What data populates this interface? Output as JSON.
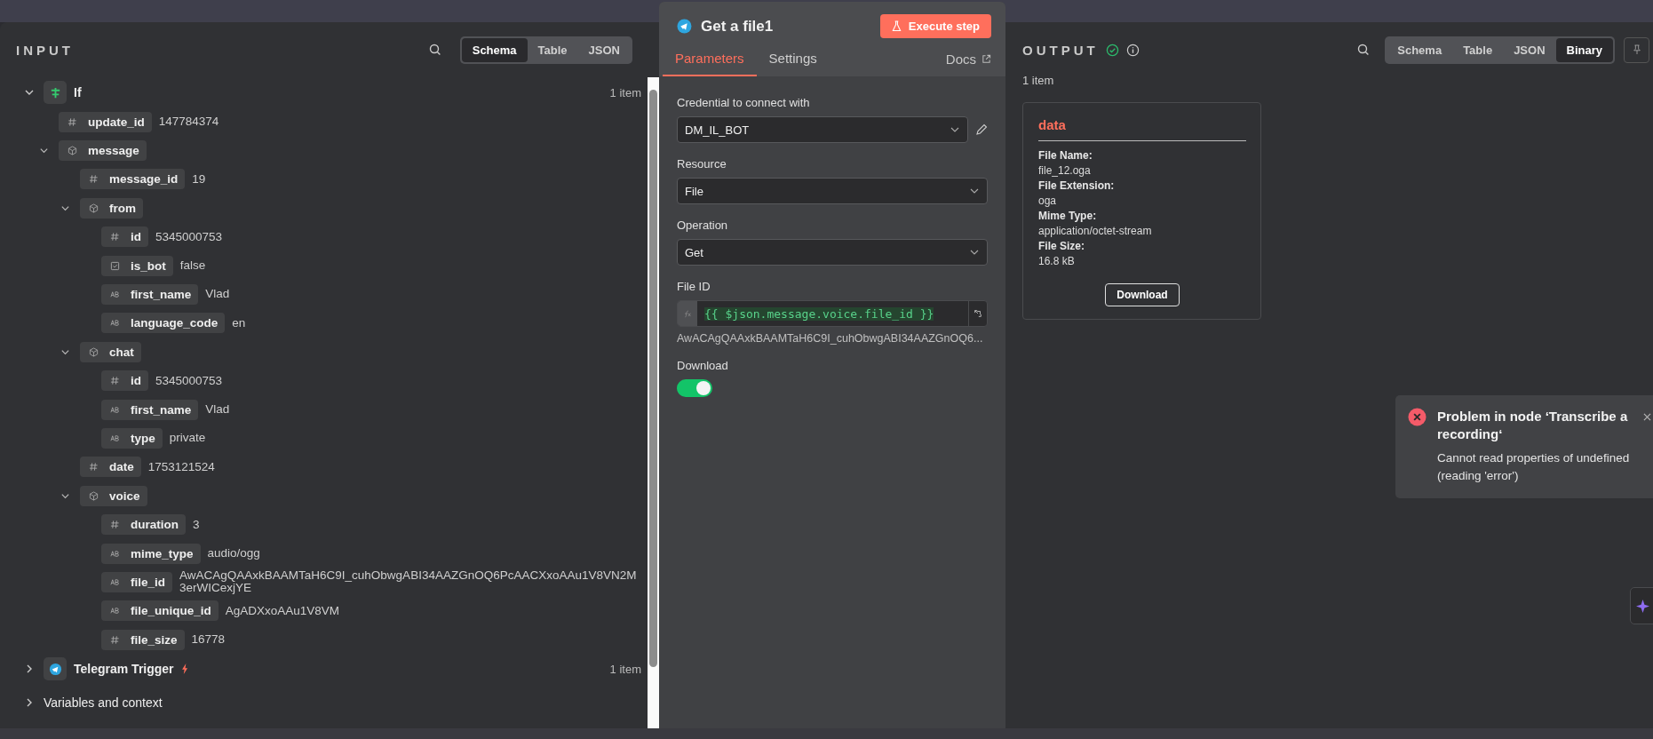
{
  "input": {
    "title": "INPUT",
    "views": [
      {
        "label": "Schema",
        "selected": true
      },
      {
        "label": "Table",
        "selected": false
      },
      {
        "label": "JSON",
        "selected": false
      }
    ],
    "sources": [
      {
        "name": "If",
        "kind": "if",
        "trigger": false,
        "count": "1 item",
        "expanded": true,
        "fields": [
          {
            "key": "update_id",
            "kind": "number",
            "value": "147784374"
          },
          {
            "key": "message",
            "kind": "object",
            "expanded": true,
            "children": [
              {
                "key": "message_id",
                "kind": "number",
                "value": "19"
              },
              {
                "key": "from",
                "kind": "object",
                "expanded": true,
                "children": [
                  {
                    "key": "id",
                    "kind": "number",
                    "value": "5345000753"
                  },
                  {
                    "key": "is_bot",
                    "kind": "boolean",
                    "value": "false"
                  },
                  {
                    "key": "first_name",
                    "kind": "string",
                    "value": "Vlad"
                  },
                  {
                    "key": "language_code",
                    "kind": "string",
                    "value": "en"
                  }
                ]
              },
              {
                "key": "chat",
                "kind": "object",
                "expanded": true,
                "children": [
                  {
                    "key": "id",
                    "kind": "number",
                    "value": "5345000753"
                  },
                  {
                    "key": "first_name",
                    "kind": "string",
                    "value": "Vlad"
                  },
                  {
                    "key": "type",
                    "kind": "string",
                    "value": "private"
                  }
                ]
              },
              {
                "key": "date",
                "kind": "number",
                "value": "1753121524"
              },
              {
                "key": "voice",
                "kind": "object",
                "expanded": true,
                "children": [
                  {
                    "key": "duration",
                    "kind": "number",
                    "value": "3"
                  },
                  {
                    "key": "mime_type",
                    "kind": "string",
                    "value": "audio/ogg"
                  },
                  {
                    "key": "file_id",
                    "kind": "string",
                    "value": "AwACAgQAAxkBAAMTaH6C9I_cuhObwgABI34AAZGnOQ6PcAACXxoAAu1V8VN2M3erWICexjYE"
                  },
                  {
                    "key": "file_unique_id",
                    "kind": "string",
                    "value": "AgADXxoAAu1V8VM"
                  },
                  {
                    "key": "file_size",
                    "kind": "number",
                    "value": "16778"
                  }
                ]
              }
            ]
          }
        ]
      },
      {
        "name": "Telegram Trigger",
        "kind": "telegram",
        "trigger": true,
        "count": "1 item",
        "expanded": false
      }
    ],
    "variables": {
      "label": "Variables and context",
      "expanded": false
    }
  },
  "node": {
    "title": "Get a file1",
    "execute_label": "Execute step",
    "tabs": [
      {
        "label": "Parameters",
        "selected": true
      },
      {
        "label": "Settings",
        "selected": false
      }
    ],
    "docs": "Docs",
    "params": [
      {
        "kind": "select",
        "label": "Credential to connect with",
        "value": "DM_IL_BOT",
        "editable": true
      },
      {
        "kind": "select",
        "label": "Resource",
        "value": "File",
        "editable": false
      },
      {
        "kind": "select",
        "label": "Operation",
        "value": "Get",
        "editable": false
      },
      {
        "kind": "expression",
        "label": "File ID",
        "value": "{{ $json.message.voice.file_id }}",
        "preview": "AwACAgQAAxkBAAMTaH6C9I_cuhObwgABI34AAZGnOQ6..."
      },
      {
        "kind": "toggle",
        "label": "Download",
        "on": true
      }
    ]
  },
  "output": {
    "title": "OUTPUT",
    "views": [
      {
        "label": "Schema",
        "selected": false
      },
      {
        "label": "Table",
        "selected": false
      },
      {
        "label": "JSON",
        "selected": false
      },
      {
        "label": "Binary",
        "selected": true
      }
    ],
    "count": "1 item",
    "binary": {
      "name": "data",
      "fields": [
        {
          "label": "File Name:",
          "value": "file_12.oga"
        },
        {
          "label": "File Extension:",
          "value": "oga"
        },
        {
          "label": "Mime Type:",
          "value": "application/octet-stream"
        },
        {
          "label": "File Size:",
          "value": "16.8 kB"
        }
      ],
      "download": "Download"
    }
  },
  "toast": {
    "kind": "error",
    "title": "Problem in node ‘Transcribe a recording‘",
    "message": "Cannot read properties of undefined (reading 'error')"
  }
}
